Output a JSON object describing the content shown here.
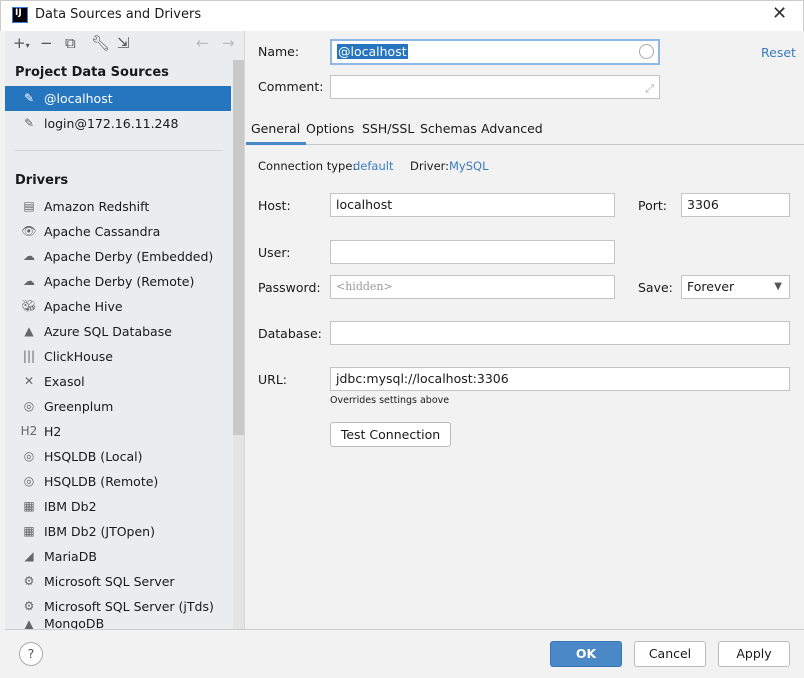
{
  "window": {
    "title": "Data Sources and Drivers",
    "app_icon": "IJ"
  },
  "toolbar": {
    "icons": [
      "add-icon",
      "remove-icon",
      "duplicate-icon",
      "wrench-icon",
      "import-icon",
      "back-arrow-icon",
      "forward-arrow-icon"
    ]
  },
  "sidebar": {
    "project_header": "Project Data Sources",
    "project_items": [
      {
        "label": "@localhost",
        "selected": true
      },
      {
        "label": "login@172.16.11.248",
        "selected": false
      }
    ],
    "drivers_header": "Drivers",
    "drivers": [
      "Amazon Redshift",
      "Apache Cassandra",
      "Apache Derby (Embedded)",
      "Apache Derby (Remote)",
      "Apache Hive",
      "Azure SQL Database",
      "ClickHouse",
      "Exasol",
      "Greenplum",
      "H2",
      "HSQLDB (Local)",
      "HSQLDB (Remote)",
      "IBM Db2",
      "IBM Db2 (JTOpen)",
      "MariaDB",
      "Microsoft SQL Server",
      "Microsoft SQL Server (jTds)",
      "MongoDB"
    ]
  },
  "form": {
    "name_label": "Name:",
    "name_value": "@localhost",
    "reset": "Reset",
    "comment_label": "Comment:",
    "comment_value": "",
    "tabs": [
      "General",
      "Options",
      "SSH/SSL",
      "Schemas",
      "Advanced"
    ],
    "active_tab": "General",
    "connection_type_label": "Connection type:",
    "connection_type": "default",
    "driver_label": "Driver:",
    "driver": "MySQL",
    "host_label": "Host:",
    "host": "localhost",
    "port_label": "Port:",
    "port": "3306",
    "user_label": "User:",
    "user": "",
    "password_label": "Password:",
    "password_placeholder": "<hidden>",
    "save_label": "Save:",
    "save_value": "Forever",
    "database_label": "Database:",
    "database": "",
    "url_label": "URL:",
    "url": "jdbc:mysql://localhost:3306",
    "url_hint": "Overrides settings above",
    "test_connection": "Test Connection"
  },
  "footer": {
    "help": "?",
    "ok": "OK",
    "cancel": "Cancel",
    "apply": "Apply"
  },
  "colors": {
    "accent": "#2675bf",
    "link": "#3a7bbf"
  }
}
